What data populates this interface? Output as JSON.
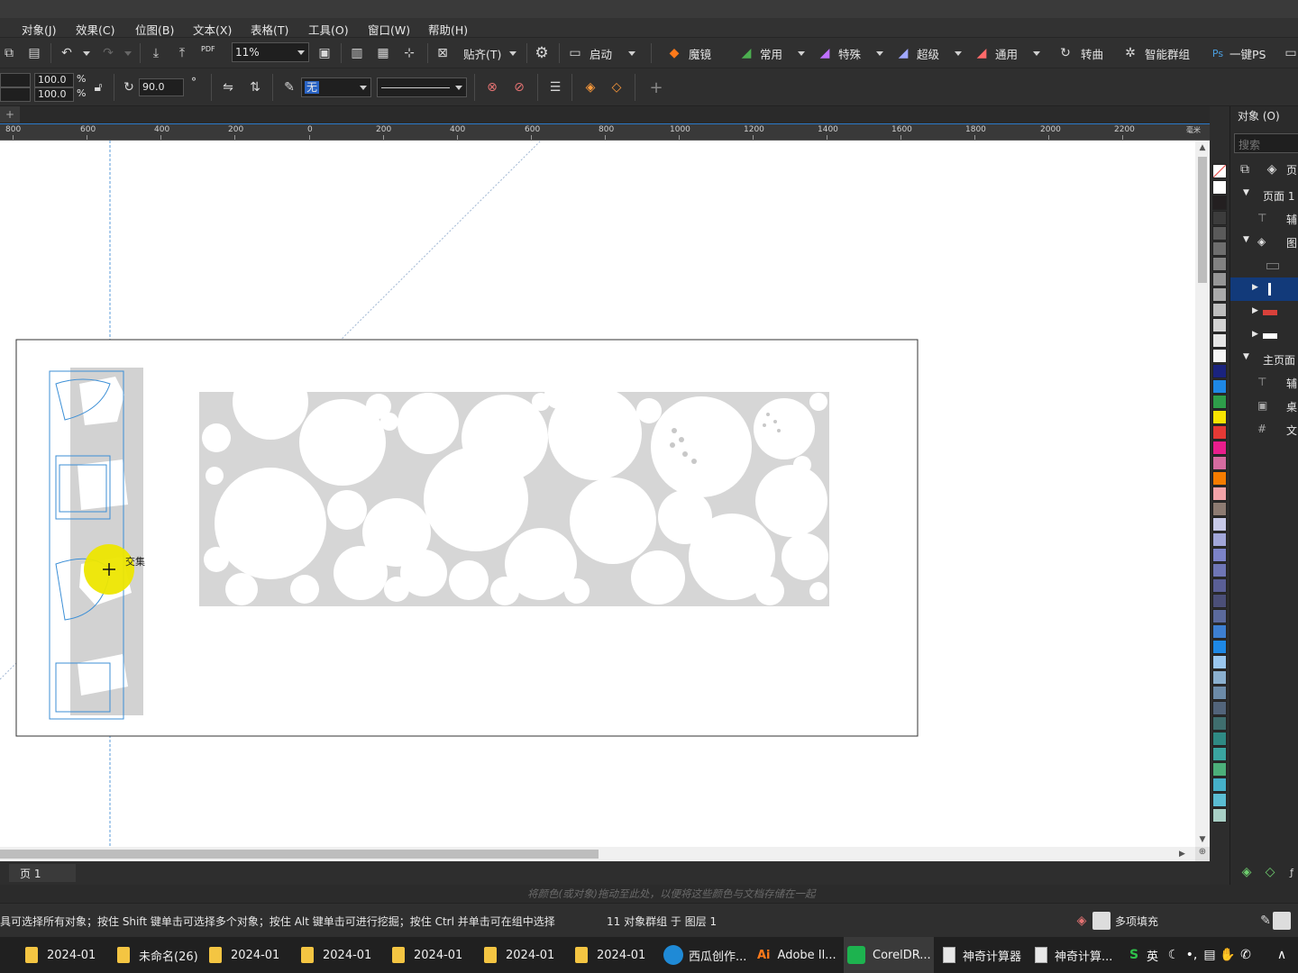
{
  "menu": [
    "对象(J)",
    "效果(C)",
    "位图(B)",
    "文本(X)",
    "表格(T)",
    "工具(O)",
    "窗口(W)",
    "帮助(H)"
  ],
  "toolbar1": {
    "zoom": "11%",
    "pdf_label": "PDF",
    "snap_label": "贴齐(T)",
    "launch_label": "启动",
    "plugins": [
      "魔镜",
      "常用",
      "特殊",
      "超级",
      "通用",
      "转曲",
      "智能群组",
      "一键PS"
    ]
  },
  "toolbar2": {
    "scale_x": "100.0",
    "scale_y": "100.0",
    "pct_x": "%",
    "pct_y": "%",
    "angle": "90.0",
    "angle_unit": "°",
    "outline": "无"
  },
  "ruler": {
    "labels": [
      "800",
      "600",
      "400",
      "200",
      "0",
      "200",
      "400",
      "600",
      "800",
      "1000",
      "1200",
      "1400",
      "1600",
      "1800",
      "2000",
      "2200"
    ],
    "unit": "毫米"
  },
  "canvas": {
    "tooltip": "交集"
  },
  "palette": [
    "#ffffff",
    "#231f20",
    "#3c3c3c",
    "#5a5a5a",
    "#6e6e6e",
    "#828282",
    "#969696",
    "#aaaaaa",
    "#bebebe",
    "#d2d2d2",
    "#e6e6e6",
    "#f5f5f5",
    "#1a237e",
    "#1e88e5",
    "#2e9e4a",
    "#f7e400",
    "#e53935",
    "#e91e8c",
    "#d66ba0",
    "#f57c00",
    "#f2a3a8",
    "#8d7b72",
    "#c7c9e8",
    "#a1a6d9",
    "#7c83c8",
    "#6f76b5",
    "#5a5f96",
    "#4b4f78",
    "#5b6a9c",
    "#3d7fd1",
    "#1e88e5",
    "#9ac7ef",
    "#8bb0cf",
    "#6c8ba8",
    "#52647a",
    "#3f6e6e",
    "#2f8a84",
    "#3aa5a0",
    "#4caf7a",
    "#45b0c8",
    "#5bbdd3",
    "#a8cfc5"
  ],
  "docker": {
    "title": "对象 (O)",
    "search_placeholder": "搜索",
    "page_tab": "页",
    "rows": [
      "页面 1",
      "辅",
      "图",
      "",
      "",
      "",
      "",
      "主页面",
      "辅",
      "桌",
      "文"
    ]
  },
  "pagebar": {
    "page": "页 1"
  },
  "hint": "将颜色(或对象)拖动至此处，以便将这些颜色与文档存储在一起",
  "status": {
    "left": "具可选择所有对象；按住 Shift 键单击可选择多个对象；按住 Alt 键单击可进行挖掘；按住 Ctrl 并单击可在组中选择",
    "selection": "11 对象群组 于 图层 1",
    "fill": "多项填充"
  },
  "taskbar": [
    {
      "label": "2024-01",
      "kind": "folder"
    },
    {
      "label": "未命名(26)",
      "kind": "folder"
    },
    {
      "label": "2024-01",
      "kind": "folder"
    },
    {
      "label": "2024-01",
      "kind": "folder"
    },
    {
      "label": "2024-01",
      "kind": "folder"
    },
    {
      "label": "2024-01",
      "kind": "folder"
    },
    {
      "label": "2024-01",
      "kind": "folder"
    },
    {
      "label": "西瓜创作...",
      "kind": "edge"
    },
    {
      "label": "Adobe Il...",
      "kind": "ai"
    },
    {
      "label": "CorelDR...",
      "kind": "corel"
    },
    {
      "label": "神奇计算器",
      "kind": "doc"
    },
    {
      "label": "神奇计算...",
      "kind": "doc"
    }
  ],
  "tray": {
    "ime": "英"
  }
}
